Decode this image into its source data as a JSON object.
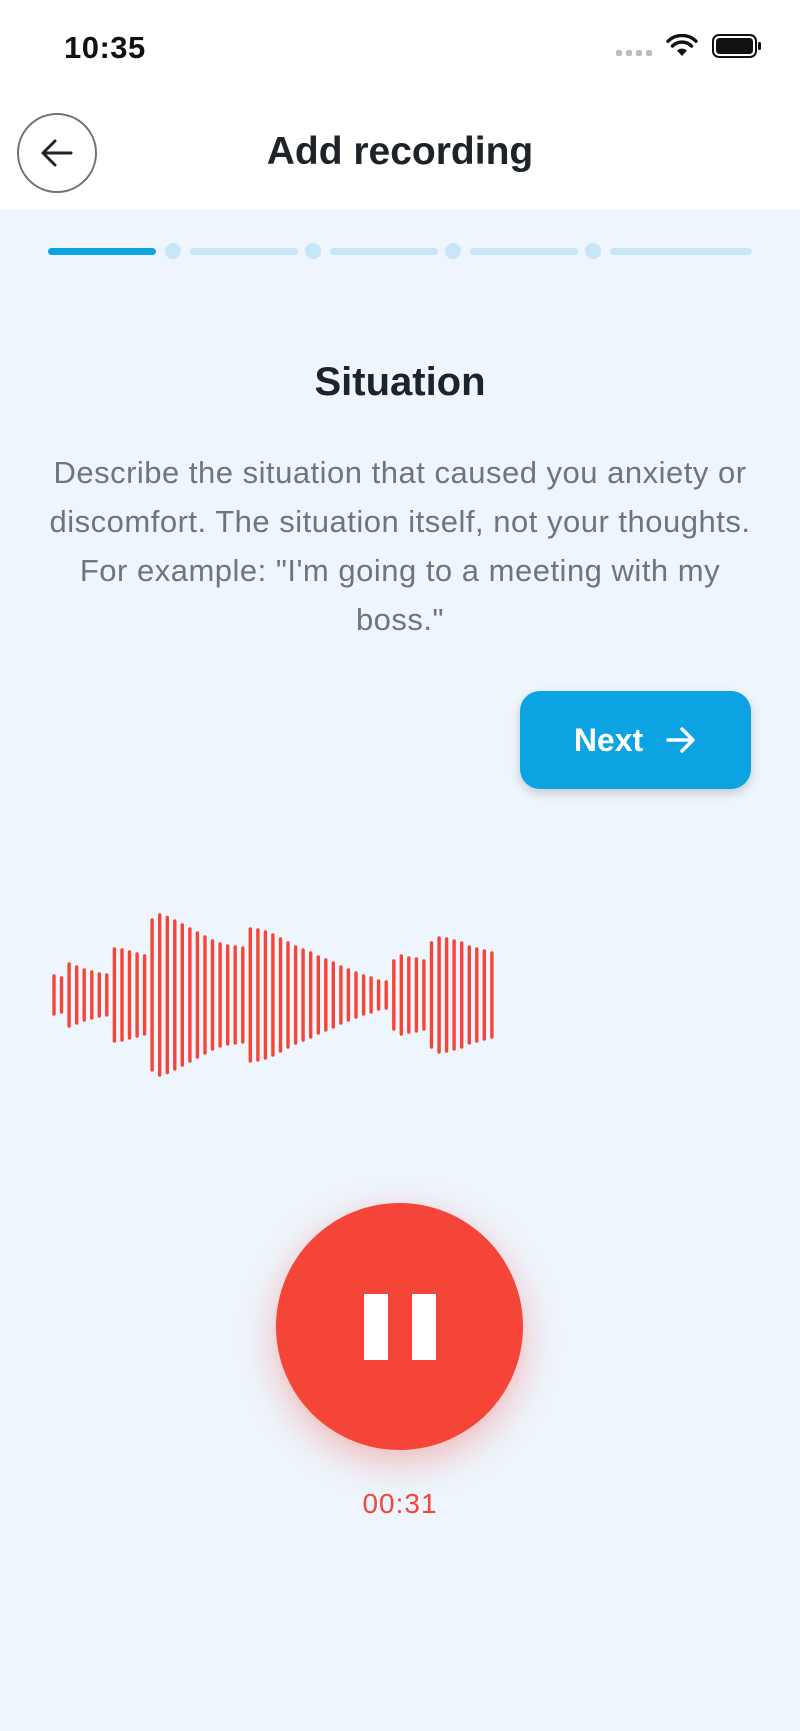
{
  "status_bar": {
    "time": "10:35",
    "icons": [
      "signal-icon",
      "wifi-icon",
      "battery-icon"
    ]
  },
  "header": {
    "back_icon": "arrow-left-icon",
    "title": "Add recording"
  },
  "progress": {
    "total_steps": 5,
    "current_step": 1
  },
  "step": {
    "title": "Situation",
    "description": "Describe the situation that caused you anxiety or discomfort. The situation itself, not your thoughts. For example: \"I'm going to a meeting with my boss.\""
  },
  "next_button": {
    "label": "Next",
    "icon": "arrow-right-icon"
  },
  "recording": {
    "state": "recording",
    "action_icon": "pause-icon",
    "timer": "00:31"
  },
  "colors": {
    "accent": "#0ba3e2",
    "record": "#f54538",
    "background": "#eef5fc",
    "progress_inactive": "#c7e6f8"
  }
}
